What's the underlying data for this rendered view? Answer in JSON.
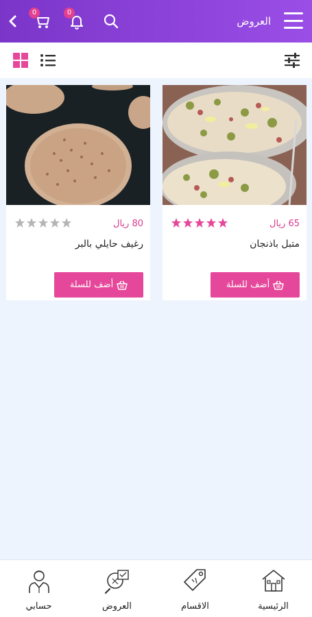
{
  "header": {
    "title": "العروض",
    "cart_count": "0",
    "notification_count": "0",
    "icons": {
      "menu": "menu-icon",
      "search": "search-icon",
      "notifications": "bell-icon",
      "cart": "cart-icon",
      "back": "chevron-left-icon"
    }
  },
  "toolbar": {
    "icons": {
      "grid": "grid-view-icon",
      "list": "list-view-icon",
      "filter": "filter-sliders-icon"
    },
    "active_view": "grid"
  },
  "products": [
    {
      "name": "متبل باذنجان",
      "price": "65 ريال",
      "rating": 5,
      "add_label": "أضف للسلة",
      "image": "eggplant-dip-photo"
    },
    {
      "name": "رغيف حايلي بالبر",
      "price": "80 ريال",
      "rating": 0,
      "add_label": "أضف للسلة",
      "image": "flatbread-photo"
    }
  ],
  "bottom_nav": [
    {
      "label": "الرئيسية",
      "icon": "home-icon"
    },
    {
      "label": "الاقسام",
      "icon": "tag-icon"
    },
    {
      "label": "العروض",
      "icon": "offers-icon"
    },
    {
      "label": "حسابي",
      "icon": "user-icon"
    }
  ],
  "colors": {
    "header_start": "#7b35c9",
    "header_end": "#9a4ee6",
    "accent": "#e5489a",
    "star_active": "#e5489a",
    "star_inactive": "#b5b5b5",
    "background": "#eef4fd"
  }
}
